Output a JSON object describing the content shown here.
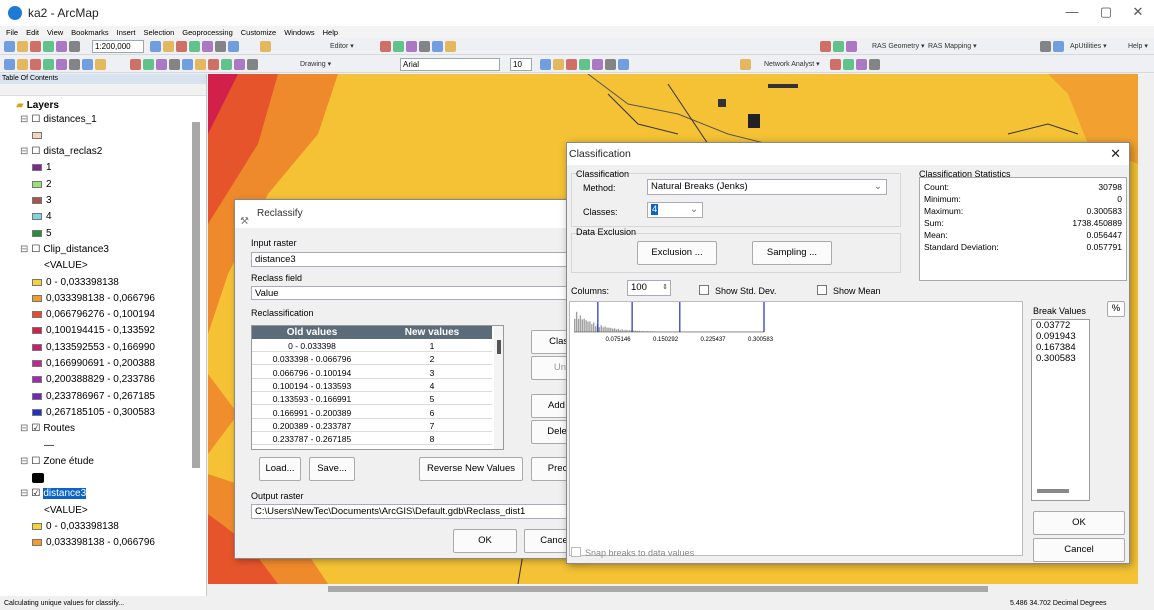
{
  "window": {
    "title": "ka2 - ArcMap"
  },
  "menubar": [
    "File",
    "Edit",
    "View",
    "Bookmarks",
    "Insert",
    "Selection",
    "Geoprocessing",
    "Customize",
    "Windows",
    "Help"
  ],
  "toolbar": {
    "scale": "1:200,000",
    "editor": "Editor ▾",
    "drawing": "Drawing ▾",
    "font": "Arial",
    "font_size": "10",
    "network_analyst": "Network Analyst ▾",
    "ras_geometry": "RAS Geometry ▾",
    "ras_mapping": "RAS Mapping ▾",
    "aputilities": "ApUtilities ▾",
    "help": "Help ▾"
  },
  "toc": {
    "header": "Table Of Contents",
    "layers_root": "Layers",
    "items": [
      {
        "label": "distances_1",
        "indent": 1,
        "type": "group"
      },
      {
        "label": "",
        "indent": 2,
        "type": "swatch",
        "color": "#f6d4bb"
      },
      {
        "label": "dista_reclas2",
        "indent": 1,
        "type": "group"
      },
      {
        "label": "1",
        "indent": 2,
        "type": "swatch",
        "color": "#7a2c86"
      },
      {
        "label": "2",
        "indent": 2,
        "type": "swatch",
        "color": "#9be07a"
      },
      {
        "label": "3",
        "indent": 2,
        "type": "swatch",
        "color": "#a3574a"
      },
      {
        "label": "4",
        "indent": 2,
        "type": "swatch",
        "color": "#7fd4e0"
      },
      {
        "label": "5",
        "indent": 2,
        "type": "swatch",
        "color": "#2c8c3c"
      },
      {
        "label": "Clip_distance3",
        "indent": 1,
        "type": "group"
      },
      {
        "label": "<VALUE>",
        "indent": 3,
        "type": "text"
      },
      {
        "label": "0 - 0,033398138",
        "indent": 2,
        "type": "swatch",
        "color": "#f5d23a"
      },
      {
        "label": "0,033398138 - 0,066796",
        "indent": 2,
        "type": "swatch",
        "color": "#f39a2c"
      },
      {
        "label": "0,066796276 - 0,100194",
        "indent": 2,
        "type": "swatch",
        "color": "#e94a2a"
      },
      {
        "label": "0,100194415 - 0,133592",
        "indent": 2,
        "type": "swatch",
        "color": "#d2204a"
      },
      {
        "label": "0,133592553 - 0,166990",
        "indent": 2,
        "type": "swatch",
        "color": "#c81e70"
      },
      {
        "label": "0,166990691 - 0,200388",
        "indent": 2,
        "type": "swatch",
        "color": "#bf2a8f"
      },
      {
        "label": "0,200388829 - 0,233786",
        "indent": 2,
        "type": "swatch",
        "color": "#a12ab0"
      },
      {
        "label": "0,233786967 - 0,267185",
        "indent": 2,
        "type": "swatch",
        "color": "#7227bf"
      },
      {
        "label": "0,267185105 - 0,300583",
        "indent": 2,
        "type": "swatch",
        "color": "#2030c8"
      },
      {
        "label": "Routes",
        "indent": 1,
        "type": "checked"
      },
      {
        "label": "—",
        "indent": 3,
        "type": "text"
      },
      {
        "label": "Zone étude",
        "indent": 1,
        "type": "group"
      },
      {
        "label": "",
        "indent": 2,
        "type": "blackbox"
      },
      {
        "label": "distance3",
        "indent": 1,
        "type": "selected"
      },
      {
        "label": "<VALUE>",
        "indent": 3,
        "type": "text"
      },
      {
        "label": "0 - 0,033398138",
        "indent": 2,
        "type": "swatch",
        "color": "#f5d23a"
      },
      {
        "label": "0,033398138 - 0,066796",
        "indent": 2,
        "type": "swatch",
        "color": "#f39a2c"
      }
    ]
  },
  "reclassify": {
    "title": "Reclassify",
    "input_raster_label": "Input raster",
    "input_raster": "distance3",
    "reclass_field_label": "Reclass field",
    "reclass_field": "Value",
    "reclassification_label": "Reclassification",
    "col_old": "Old values",
    "col_new": "New values",
    "rows": [
      [
        "0 - 0.033398",
        "1"
      ],
      [
        "0.033398 - 0.066796",
        "2"
      ],
      [
        "0.066796 - 0.100194",
        "3"
      ],
      [
        "0.100194 - 0.133593",
        "4"
      ],
      [
        "0.133593 - 0.166991",
        "5"
      ],
      [
        "0.166991 - 0.200389",
        "6"
      ],
      [
        "0.200389 - 0.233787",
        "7"
      ],
      [
        "0.233787 - 0.267185",
        "8"
      ]
    ],
    "classify_btn": "Class",
    "unique_btn": "Uni",
    "add_btn": "Add E",
    "delete_btn": "Delete",
    "load_btn": "Load...",
    "save_btn": "Save...",
    "reverse_btn": "Reverse New Values",
    "precision_btn": "Precis",
    "output_raster_label": "Output raster",
    "output_raster": "C:\\Users\\NewTec\\Documents\\ArcGIS\\Default.gdb\\Reclass_dist1",
    "ok_btn": "OK",
    "cancel_btn": "Cance"
  },
  "classification": {
    "title": "Classification",
    "group_label": "Classification",
    "method_label": "Method:",
    "method": "Natural Breaks (Jenks)",
    "classes_label": "Classes:",
    "classes": "4",
    "exclusion_label": "Data Exclusion",
    "exclusion_btn": "Exclusion ...",
    "sampling_btn": "Sampling ...",
    "stats_label": "Classification Statistics",
    "stats": [
      {
        "k": "Count:",
        "v": "30798"
      },
      {
        "k": "Minimum:",
        "v": "0"
      },
      {
        "k": "Maximum:",
        "v": "0.300583"
      },
      {
        "k": "Sum:",
        "v": "1738.450889"
      },
      {
        "k": "Mean:",
        "v": "0.056447"
      },
      {
        "k": "Standard Deviation:",
        "v": "0.057791"
      }
    ],
    "columns_label": "Columns:",
    "columns": "100",
    "std_dev_label": "Show Std. Dev.",
    "mean_label": "Show Mean",
    "break_values_label": "Break Values",
    "pct_btn": "%",
    "break_values": [
      "0.03772",
      "0.091943",
      "0.167384",
      "0.300583"
    ],
    "hist_ticks": [
      "0.075146",
      "0.150292",
      "0.225437",
      "0.300583"
    ],
    "snap_label": "Snap breaks to data values",
    "ok_btn": "OK",
    "cancel_btn": "Cancel"
  },
  "status": {
    "left": "Calculating unique values for classify...",
    "right": "5.486 34.702 Decimal Degrees"
  },
  "colors": {
    "map_bg": "#f4c234",
    "accent": "#0a64c8"
  }
}
